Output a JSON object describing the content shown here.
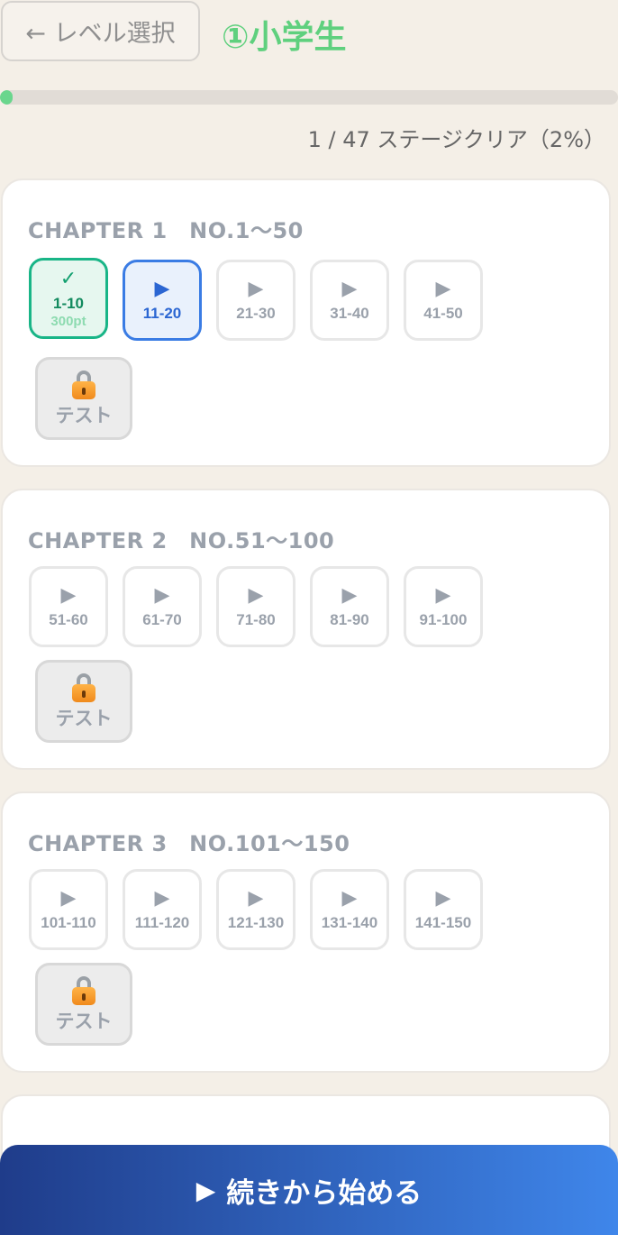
{
  "header": {
    "back_label": "← レベル選択",
    "level_title": "①小学生"
  },
  "progress": {
    "cleared": 1,
    "total": 47,
    "percent": 2,
    "text": "1 / 47 ステージクリア（2%）"
  },
  "chapters": [
    {
      "title": "CHAPTER 1　NO.1〜50",
      "stages": [
        {
          "label": "1-10",
          "status": "cleared",
          "icon": "check-icon",
          "points": "300pt"
        },
        {
          "label": "11-20",
          "status": "current",
          "icon": "play-icon"
        },
        {
          "label": "21-30",
          "status": "open",
          "icon": "play-icon"
        },
        {
          "label": "31-40",
          "status": "open",
          "icon": "play-icon"
        },
        {
          "label": "41-50",
          "status": "open",
          "icon": "play-icon"
        }
      ],
      "test_label": "テスト"
    },
    {
      "title": "CHAPTER 2　NO.51〜100",
      "stages": [
        {
          "label": "51-60",
          "status": "open",
          "icon": "play-icon"
        },
        {
          "label": "61-70",
          "status": "open",
          "icon": "play-icon"
        },
        {
          "label": "71-80",
          "status": "open",
          "icon": "play-icon"
        },
        {
          "label": "81-90",
          "status": "open",
          "icon": "play-icon"
        },
        {
          "label": "91-100",
          "status": "open",
          "icon": "play-icon"
        }
      ],
      "test_label": "テスト"
    },
    {
      "title": "CHAPTER 3　NO.101〜150",
      "stages": [
        {
          "label": "101-110",
          "status": "open",
          "icon": "play-icon"
        },
        {
          "label": "111-120",
          "status": "open",
          "icon": "play-icon"
        },
        {
          "label": "121-130",
          "status": "open",
          "icon": "play-icon"
        },
        {
          "label": "131-140",
          "status": "open",
          "icon": "play-icon"
        },
        {
          "label": "141-150",
          "status": "open",
          "icon": "play-icon"
        }
      ],
      "test_label": "テスト"
    }
  ],
  "cta": {
    "label": "続きから始める"
  },
  "colors": {
    "background": "#f4efe7",
    "accent_green": "#5fd07e",
    "cleared_border": "#19b587",
    "current_border": "#3a7ce4",
    "cta_start": "#1f3c8a",
    "cta_end": "#3f86ea"
  }
}
